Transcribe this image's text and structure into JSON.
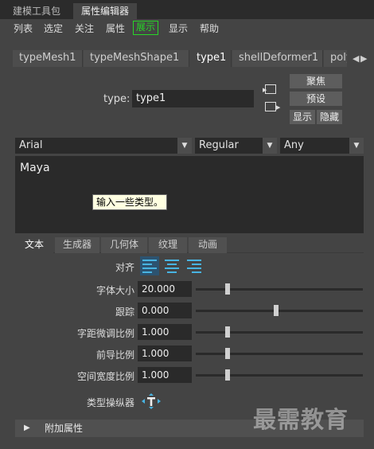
{
  "top_tabs": [
    "建模工具包",
    "属性编辑器"
  ],
  "menu": [
    "列表",
    "选定",
    "关注",
    "属性",
    "展示",
    "显示",
    "帮助"
  ],
  "node_tabs": [
    "typeMesh1",
    "typeMeshShape1",
    "type1",
    "shellDeformer1",
    "poly"
  ],
  "type_node": {
    "label": "type:",
    "value": "type1"
  },
  "side_buttons": {
    "focus": "聚焦",
    "presets": "预设",
    "show": "显示",
    "hide": "隐藏"
  },
  "font": {
    "family": "Arial",
    "style": "Regular",
    "language": "Any"
  },
  "text_input": {
    "value": "Maya",
    "tooltip": "输入一些类型。"
  },
  "sub_tabs": [
    "文本",
    "生成器",
    "几何体",
    "纹理",
    "动画"
  ],
  "alignment": {
    "label": "对齐"
  },
  "params": [
    {
      "label": "字体大小",
      "value": "20.000",
      "slider": 0.19
    },
    {
      "label": "跟踪",
      "value": "0.000",
      "slider": 0.48
    },
    {
      "label": "字距微调比例",
      "value": "1.000",
      "slider": 0.19
    },
    {
      "label": "前导比例",
      "value": "1.000",
      "slider": 0.19
    },
    {
      "label": "空间宽度比例",
      "value": "1.000",
      "slider": 0.19
    }
  ],
  "manipulator": {
    "label": "类型操纵器"
  },
  "extra_attributes": {
    "label": "附加属性"
  },
  "watermark": "最需教育",
  "colors": {
    "highlight_green": "#27d627",
    "align_blue": "#48b4e2",
    "tooltip_bg": "#ffffe1"
  }
}
